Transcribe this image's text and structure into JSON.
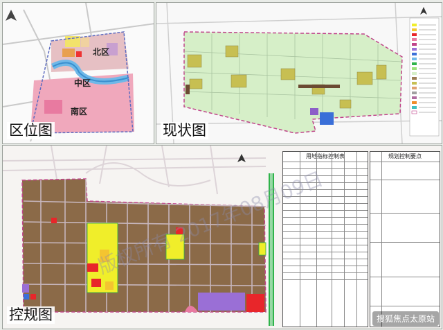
{
  "panels": {
    "location": {
      "caption": "区位图",
      "zones": {
        "north": "北区",
        "middle": "中区",
        "south": "南区"
      }
    },
    "status": {
      "caption": "现状图"
    },
    "regulatory": {
      "caption": "控规图",
      "table_title": "用地指标控制表",
      "notes_title": "规划控制要点"
    }
  },
  "watermark": "版权所有 2017年08月09日",
  "brand": "搜狐焦点太原站",
  "colors": {
    "residential": "#f0ee2a",
    "village": "#9b7b52",
    "commercial": "#e8262a",
    "industrial": "#9a6fd6",
    "green": "#2fb34a",
    "road": "#d8d0d4",
    "water": "#6fb8e8",
    "status_base": "#d6efc8",
    "boundary": "#c0448a"
  }
}
